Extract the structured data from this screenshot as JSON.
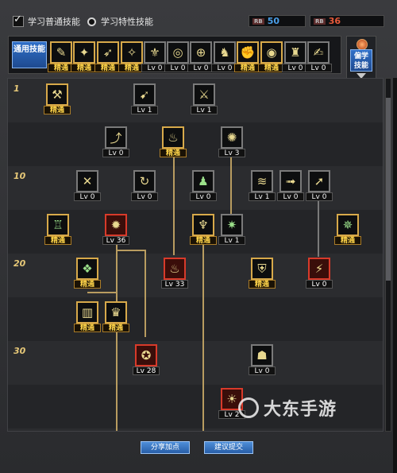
{
  "options": {
    "normal_skills": "学习普通技能",
    "special_skills": "学习特性技能"
  },
  "points": [
    {
      "tag": "RB",
      "value": "50",
      "color": "#4a9ee8"
    },
    {
      "tag": "RB",
      "value": "36",
      "color": "#e85a3a"
    }
  ],
  "common": {
    "label": "通用技能",
    "skills": [
      {
        "level": "精通",
        "icon": "sitting-figure-icon",
        "glyph": "✎"
      },
      {
        "level": "精通",
        "icon": "kick-icon",
        "glyph": "✦"
      },
      {
        "level": "精通",
        "icon": "sprint-icon",
        "glyph": "➶"
      },
      {
        "level": "精通",
        "icon": "run-icon",
        "glyph": "✧"
      },
      {
        "level": "Lv 0",
        "icon": "wings-icon",
        "glyph": "⚜"
      },
      {
        "level": "Lv 0",
        "icon": "target-icon",
        "glyph": "◎"
      },
      {
        "level": "Lv 0",
        "icon": "crosshair-icon",
        "glyph": "⊕"
      },
      {
        "level": "Lv 0",
        "icon": "stance-icon",
        "glyph": "♞"
      },
      {
        "level": "精通",
        "icon": "fist-icon",
        "glyph": "✊"
      },
      {
        "level": "精通",
        "icon": "eye-icon",
        "glyph": "◉"
      },
      {
        "level": "Lv 0",
        "icon": "warrior-icon",
        "glyph": "♜"
      },
      {
        "level": "Lv 0",
        "icon": "scroll-icon",
        "glyph": "✍"
      }
    ]
  },
  "profession": {
    "label": "偏学技能"
  },
  "rows": [
    "1",
    "",
    "10",
    "",
    "20",
    "",
    "30",
    ""
  ],
  "tree_skills": [
    {
      "level": "精通",
      "icon": "staff-icon",
      "glyph": "⚒"
    },
    {
      "level": "Lv 1",
      "icon": "dash-icon",
      "glyph": "➹"
    },
    {
      "level": "Lv 1",
      "icon": "slash-icon",
      "glyph": "⚔"
    },
    {
      "level": "Lv 0",
      "icon": "leap-icon",
      "glyph": "⤴"
    },
    {
      "level": "精通",
      "icon": "spirit-icon",
      "glyph": "♨"
    },
    {
      "level": "Lv 3",
      "icon": "burst-icon",
      "glyph": "✺"
    },
    {
      "level": "Lv 0",
      "icon": "cross-strike-icon",
      "glyph": "✕"
    },
    {
      "level": "Lv 0",
      "icon": "spin-icon",
      "glyph": "↻"
    },
    {
      "level": "Lv 0",
      "icon": "guardian-icon",
      "glyph": "♟"
    },
    {
      "level": "Lv 1",
      "icon": "claw-icon",
      "glyph": "≋"
    },
    {
      "level": "Lv 0",
      "icon": "charge-icon",
      "glyph": "➟"
    },
    {
      "level": "Lv 0",
      "icon": "thrust-icon",
      "glyph": "➚"
    },
    {
      "level": "精通",
      "icon": "giant-icon",
      "glyph": "♖"
    },
    {
      "level": "Lv 36",
      "icon": "flame-icon",
      "glyph": "✹"
    },
    {
      "level": "精通",
      "icon": "pillar-icon",
      "glyph": "♆"
    },
    {
      "level": "Lv 1",
      "icon": "green-star-icon",
      "glyph": "✷"
    },
    {
      "level": "精通",
      "icon": "emerald-icon",
      "glyph": "✵"
    },
    {
      "level": "精通",
      "icon": "dragon-icon",
      "glyph": "❖"
    },
    {
      "level": "Lv 33",
      "icon": "fire-totem-icon",
      "glyph": "♨"
    },
    {
      "level": "精通",
      "icon": "shield-icon",
      "glyph": "⛨"
    },
    {
      "level": "Lv 0",
      "icon": "rage-icon",
      "glyph": "⚡"
    },
    {
      "level": "精通",
      "icon": "gate-icon",
      "glyph": "▥"
    },
    {
      "level": "精通",
      "icon": "bell-icon",
      "glyph": "♛"
    },
    {
      "level": "Lv 28",
      "icon": "berserk-icon",
      "glyph": "✪"
    },
    {
      "level": "Lv 0",
      "icon": "crouch-icon",
      "glyph": "☗"
    },
    {
      "level": "Lv 2",
      "icon": "inferno-icon",
      "glyph": "☀"
    }
  ],
  "buttons": {
    "share": "分享加点",
    "submit": "建议提交"
  },
  "watermark": "大东手游"
}
